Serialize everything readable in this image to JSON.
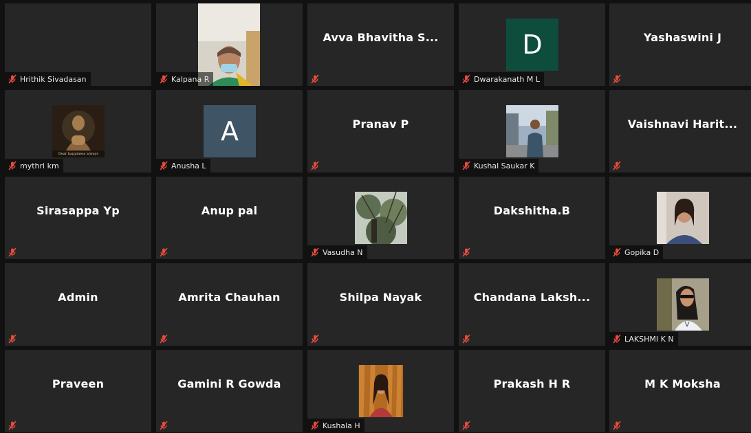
{
  "app": {
    "mute_icon": "mic-muted-icon",
    "mute_color": "#e84c3d",
    "tile_bg": "#262626",
    "gap_bg": "#111111"
  },
  "participants": [
    {
      "name": "Hrithik Sivadasan",
      "display": "label",
      "avatar_letter": "",
      "avatar_color": ""
    },
    {
      "name": "Kalpana R",
      "display": "photo",
      "photo": "person-face-photo"
    },
    {
      "name": "Avva  Bhavitha  S...",
      "display": "center"
    },
    {
      "name": "Dwarakanath M L",
      "display": "avatar",
      "avatar_letter": "D",
      "avatar_color": "#0e4d3b"
    },
    {
      "name": "Yashaswini J",
      "display": "center"
    },
    {
      "name": "mythri km",
      "display": "photo",
      "photo": "buddha-statue-photo",
      "photo_caption": "Dear happiness always"
    },
    {
      "name": "Anusha L",
      "display": "avatar",
      "avatar_letter": "A",
      "avatar_color": "#3f5566"
    },
    {
      "name": "Pranav P",
      "display": "center"
    },
    {
      "name": "Kushal Saukar K",
      "display": "photo",
      "photo": "person-street-photo"
    },
    {
      "name": "Vaishnavi  Harit...",
      "display": "center"
    },
    {
      "name": "Sirasappa Yp",
      "display": "center"
    },
    {
      "name": "Anup pal",
      "display": "center"
    },
    {
      "name": "Vasudha N",
      "display": "photo",
      "photo": "trees-photo"
    },
    {
      "name": "Dakshitha.B",
      "display": "center"
    },
    {
      "name": "Gopika D",
      "display": "photo",
      "photo": "person-portrait-photo"
    },
    {
      "name": "Admin",
      "display": "center"
    },
    {
      "name": "Amrita Chauhan",
      "display": "center"
    },
    {
      "name": "Shilpa Nayak",
      "display": "center"
    },
    {
      "name": "Chandana  Laksh...",
      "display": "center"
    },
    {
      "name": "LAKSHMI K N",
      "display": "photo",
      "photo": "person-sunglasses-photo"
    },
    {
      "name": "Praveen",
      "display": "center"
    },
    {
      "name": "Gamini R Gowda",
      "display": "center"
    },
    {
      "name": "Kushala H",
      "display": "photo",
      "photo": "person-curtain-photo"
    },
    {
      "name": "Prakash H R",
      "display": "center"
    },
    {
      "name": "M K Moksha",
      "display": "center"
    }
  ]
}
